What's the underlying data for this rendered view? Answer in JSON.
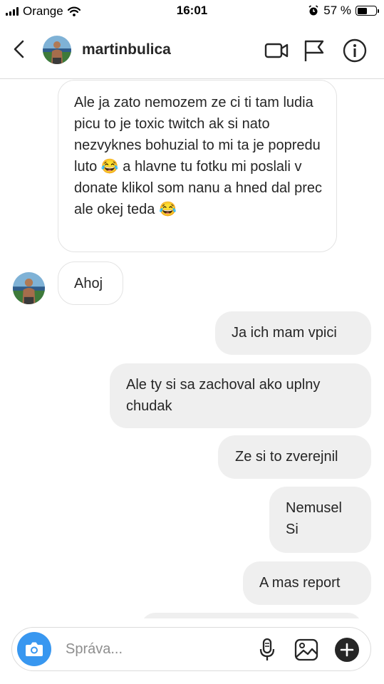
{
  "status_bar": {
    "carrier": "Orange",
    "time": "16:01",
    "battery_text": "57 %",
    "battery_level": 0.57
  },
  "header": {
    "username": "martinbulica"
  },
  "messages": [
    {
      "direction": "incoming",
      "text": "Ale ja zato nemozem ze ci ti tam ludia picu to je toxic twitch ak si nato nezvyknes bohuzial to mi ta je popredu luto 😂 a hlavne tu fotku mi poslali v donate klikol som nanu a hned dal prec ale okej teda 😂"
    },
    {
      "direction": "incoming",
      "text": "Ahoj"
    },
    {
      "direction": "outgoing",
      "text": "Ja ich mam vpici"
    },
    {
      "direction": "outgoing",
      "text": "Ale ty si sa zachoval ako uplny chudak"
    },
    {
      "direction": "outgoing",
      "text": "Ze si to zverejnil"
    },
    {
      "direction": "outgoing",
      "text": "Nemusel Si"
    },
    {
      "direction": "outgoing",
      "text": "A mas report"
    }
  ],
  "composer": {
    "placeholder": "Správa..."
  },
  "icons": {
    "back": "chevron-left-icon",
    "video": "video-camera-icon",
    "report": "flag-icon",
    "info": "info-icon",
    "camera": "camera-icon",
    "microphone": "microphone-icon",
    "gallery": "image-icon",
    "more": "plus-circle-icon"
  },
  "colors": {
    "camera_button": "#3897f0",
    "outgoing_bubble": "#efefef",
    "incoming_border": "#e3e3e3"
  }
}
